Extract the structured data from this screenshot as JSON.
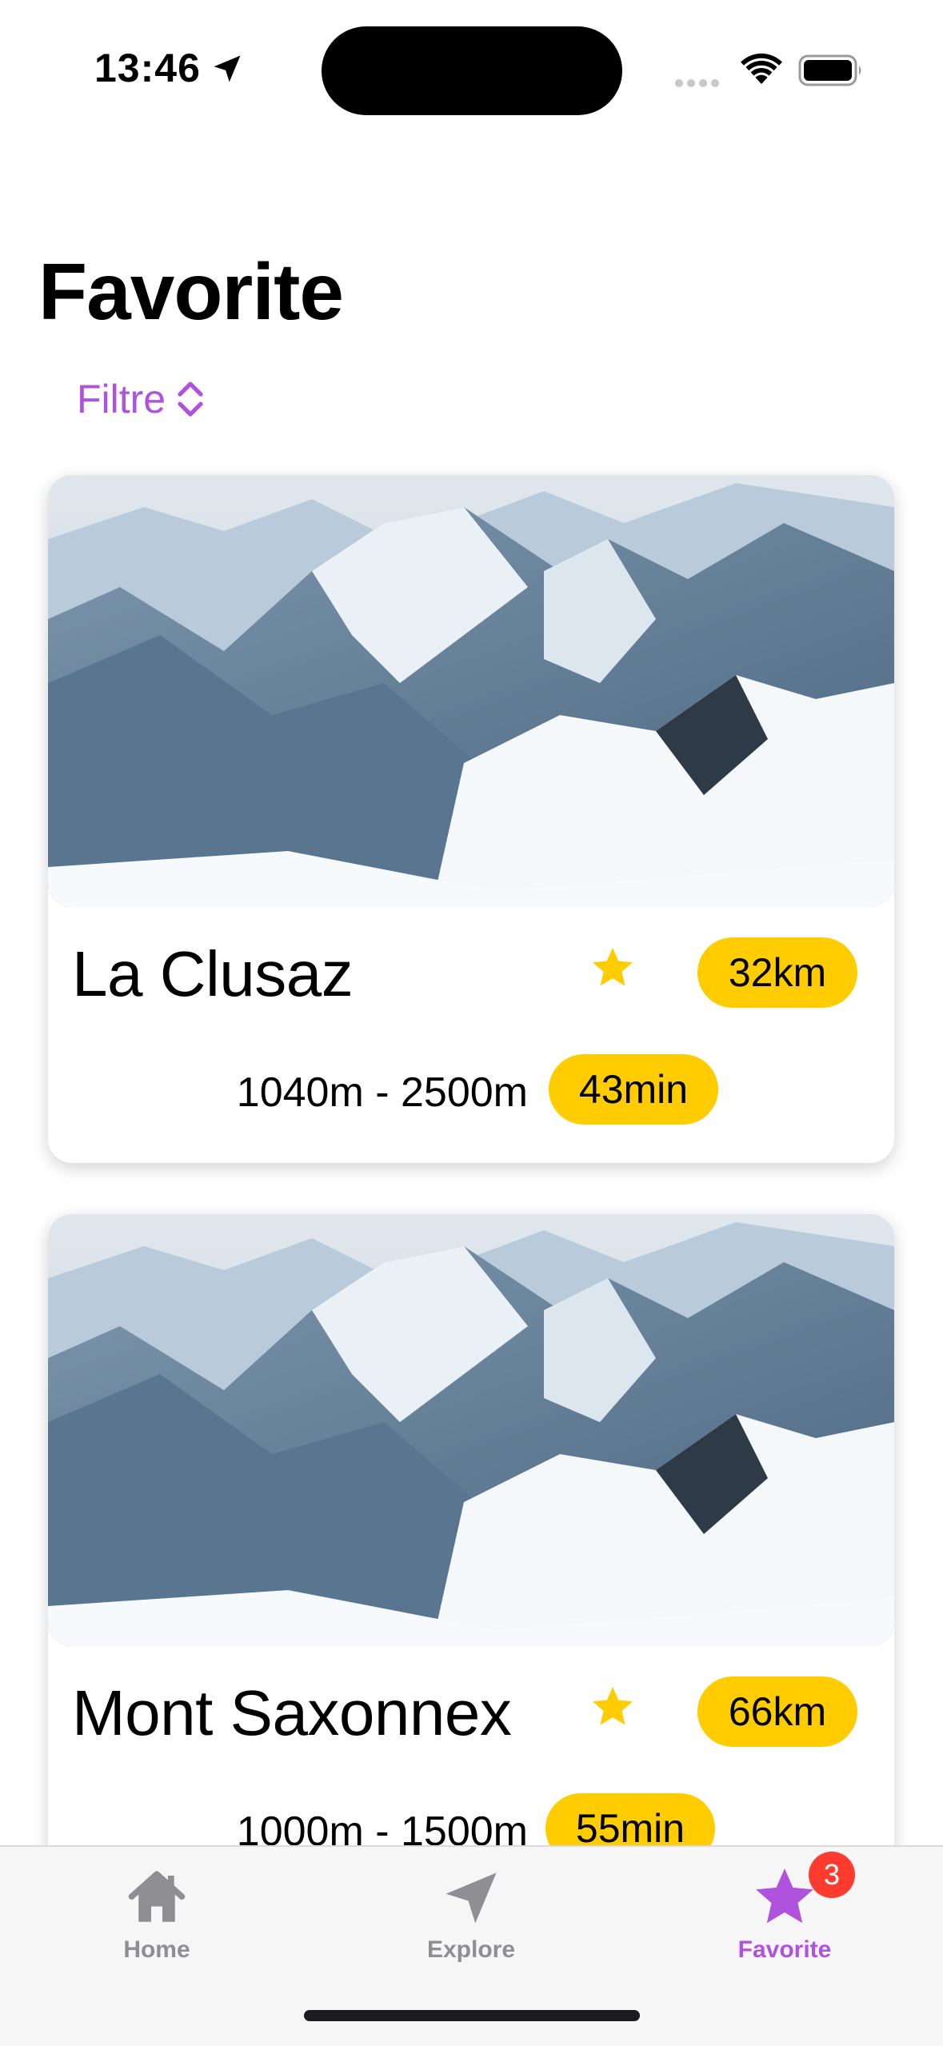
{
  "status_bar": {
    "time": "13:46"
  },
  "header": {
    "title": "Favorite",
    "filter_label": "Filtre"
  },
  "resorts": [
    {
      "name": "La Clusaz",
      "favorite": true,
      "distance": "32km",
      "altitude": "1040m - 2500m",
      "travel_time": "43min"
    },
    {
      "name": "Mont Saxonnex",
      "favorite": true,
      "distance": "66km",
      "altitude": "1000m - 1500m",
      "travel_time": "55min"
    }
  ],
  "tabbar": {
    "tabs": [
      {
        "label": "Home",
        "icon": "house-icon",
        "active": false
      },
      {
        "label": "Explore",
        "icon": "location-arrow-icon",
        "active": false
      },
      {
        "label": "Favorite",
        "icon": "star-icon",
        "active": true,
        "badge": "3"
      }
    ]
  },
  "colors": {
    "accent": "#af52de",
    "pill": "#ffcc00",
    "star": "#ffcc00",
    "badge": "#ff3b30",
    "inactive_tab": "#8e8e93"
  }
}
